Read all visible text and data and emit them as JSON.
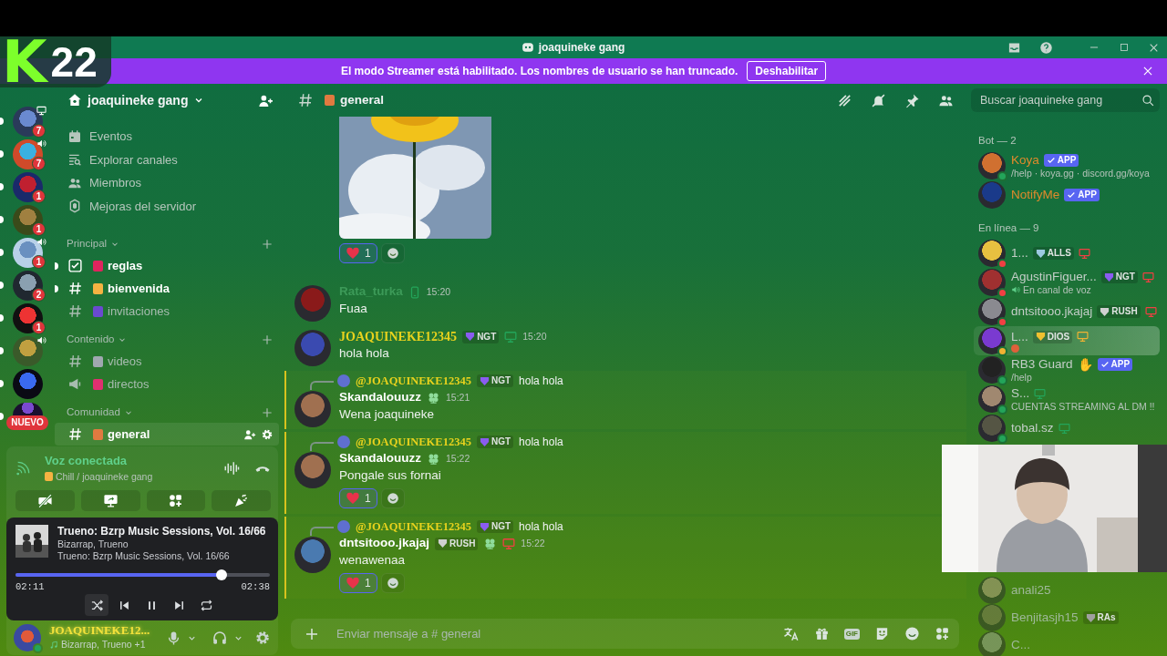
{
  "window": {
    "title": "joaquineke gang"
  },
  "overlay_logo": {
    "letter": "K",
    "number": "22"
  },
  "streamer_banner": {
    "message": "El modo Streamer está habilitado. Los nombres de usuario se han truncado.",
    "button": "Deshabilitar"
  },
  "servers": [
    {
      "unread": true,
      "badge": "7",
      "voice": false,
      "streaming": true
    },
    {
      "unread": true,
      "badge": "7",
      "voice": true,
      "streaming": false
    },
    {
      "unread": true,
      "badge": "1",
      "voice": false,
      "streaming": false
    },
    {
      "unread": true,
      "badge": "1",
      "voice": false,
      "streaming": false
    },
    {
      "unread": true,
      "badge": "1",
      "voice": true,
      "streaming": false
    },
    {
      "unread": true,
      "badge": "2",
      "voice": false,
      "streaming": false
    },
    {
      "unread": true,
      "badge": "1",
      "voice": false,
      "streaming": false
    },
    {
      "unread": true,
      "voice": true,
      "streaming": false
    },
    {
      "unread": true,
      "voice": false,
      "streaming": false
    },
    {
      "unread": true,
      "voice": false,
      "streaming": false,
      "label": "NUEVO"
    }
  ],
  "channel_sidebar": {
    "server_name": "joaquineke gang",
    "menu": [
      {
        "label": "Eventos"
      },
      {
        "label": "Explorar canales"
      },
      {
        "label": "Miembros"
      },
      {
        "label": "Mejoras del servidor"
      }
    ],
    "categories": [
      {
        "name": "Principal",
        "channels": [
          {
            "name": "reglas",
            "kind": "rules",
            "unread": true,
            "selected": false
          },
          {
            "name": "bienvenida",
            "kind": "text",
            "unread": true,
            "selected": false
          },
          {
            "name": "invitaciones",
            "kind": "text",
            "unread": false,
            "selected": false
          }
        ]
      },
      {
        "name": "Contenido",
        "channels": [
          {
            "name": "videos",
            "kind": "text",
            "unread": false,
            "selected": false
          },
          {
            "name": "directos",
            "kind": "announcement",
            "unread": false,
            "selected": false
          }
        ]
      },
      {
        "name": "Comunidad",
        "channels": [
          {
            "name": "general",
            "kind": "text",
            "unread": false,
            "selected": true
          }
        ]
      }
    ]
  },
  "voice": {
    "status": "Voz conectada",
    "channel": "Chill / joaquineke gang"
  },
  "now_playing": {
    "title": "Trueno: Bzrp Music Sessions, Vol. 16/66",
    "artists": "Bizarrap, Trueno",
    "album": "Trueno: Bzrp Music Sessions, Vol. 16/66",
    "level": 0.81,
    "elapsed": "02:11",
    "duration": "02:38",
    "shuffle": true
  },
  "user": {
    "name": "JOAQUINEKE12...",
    "activity": "Bizarrap, Trueno +1",
    "status": {
      "color": "#23a55a"
    },
    "fancy_name": true
  },
  "chat": {
    "channel": "general",
    "search": {
      "placeholder": "Buscar joaquineke gang"
    },
    "messages": [
      {
        "reactions": [
          {
            "count": "1",
            "selected": true
          }
        ]
      },
      {
        "kind": "message",
        "author": "Rata_turka",
        "color": "#3c9a58",
        "mobile": true,
        "status": {
          "color": "#23a55a"
        },
        "time": "15:20",
        "text": "Fuaa"
      },
      {
        "kind": "message",
        "author": "JOAQUINEKE12345",
        "color": "#e8d21d",
        "fancy_name": true,
        "tag": {
          "text": "NGT",
          "color": "#8a5cf0"
        },
        "desktop": true,
        "status": {
          "color": "#23a55a"
        },
        "time": "15:20",
        "text": "hola hola"
      },
      {
        "kind": "reply",
        "mentioned": true,
        "reply": {
          "author": "@JOAQUINEKE12345",
          "color": "#e8d21d",
          "fancy_name": true,
          "tag": {
            "text": "NGT",
            "color": "#8a5cf0"
          },
          "text": "hola hola"
        },
        "author": "Skandalouuzz",
        "color": "#ffffff",
        "badge": true,
        "time": "15:21",
        "text": "Wena joaquineke"
      },
      {
        "kind": "reply",
        "mentioned": true,
        "reply": {
          "author": "@JOAQUINEKE12345",
          "color": "#e8d21d",
          "fancy_name": true,
          "tag": {
            "text": "NGT",
            "color": "#8a5cf0"
          },
          "text": "hola hola"
        },
        "author": "Skandalouuzz",
        "color": "#ffffff",
        "badge": true,
        "time": "15:22",
        "text": "Pongale sus fornai",
        "reactions": [
          {
            "count": "1",
            "selected": true
          }
        ]
      },
      {
        "kind": "reply",
        "mentioned": true,
        "reply": {
          "author": "@JOAQUINEKE12345",
          "color": "#e8d21d",
          "fancy_name": true,
          "tag": {
            "text": "NGT",
            "color": "#8a5cf0"
          },
          "text": "hola hola"
        },
        "author": "dntsitooo.jkajaj",
        "color": "#ffffff",
        "tag": {
          "text": "RUSH",
          "color": "#d0d0d0"
        },
        "badge": true,
        "desktop": true,
        "status": {
          "color": "#f23f43"
        },
        "time": "15:22",
        "text": "wenawenaa",
        "reactions": [
          {
            "count": "1",
            "selected": true
          }
        ]
      }
    ],
    "input": {
      "placeholder": "Enviar mensaje a # general",
      "gif_label": "GIF"
    }
  },
  "members": [
    {
      "title": "Bot — 2",
      "members": [
        {
          "name": "Koya",
          "color": "#e08a2c",
          "status": {
            "color": "#23a55a"
          },
          "tag": {
            "text": "APP",
            "kind": "app"
          },
          "subtitle": "/help · koya.gg · discord.gg/koya"
        },
        {
          "name": "NotifyMe",
          "color": "#e08a2c",
          "tag": {
            "text": "APP",
            "kind": "app"
          }
        }
      ]
    },
    {
      "title": "En línea — 9",
      "members": [
        {
          "name": "1...",
          "status": {
            "color": "#f23f43"
          },
          "tag": {
            "text": "ALLS",
            "kind": "role",
            "color": "#9cc8e0"
          },
          "desktop": true
        },
        {
          "name": "AgustinFiguer...",
          "status": {
            "color": "#f23f43"
          },
          "tag": {
            "text": "NGT",
            "kind": "role",
            "color": "#8a5cf0"
          },
          "desktop": true,
          "subtitle": "En canal de voz",
          "in_voice": true
        },
        {
          "name": "dntsitooo.jkajaj",
          "status": {
            "color": "#f23f43"
          },
          "tag": {
            "text": "RUSH",
            "kind": "role",
            "color": "#d0d0d0"
          },
          "desktop": true
        },
        {
          "name": "L...",
          "status": {
            "color": "#f0b232"
          },
          "tag": {
            "text": "DIOS",
            "kind": "role",
            "color": "#f0c030"
          },
          "desktop": true,
          "highlighted": true,
          "status_emoji": true
        },
        {
          "name": "RB3 Guard",
          "status": {
            "color": "#23a55a"
          },
          "emoji": "✋",
          "tag": {
            "text": "APP",
            "kind": "app"
          },
          "subtitle": "/help"
        },
        {
          "name": "S...",
          "status": {
            "color": "#23a55a"
          },
          "desktop": true,
          "subtitle": "CUENTAS STREAMING AL DM !!"
        },
        {
          "name": "tobal.sz",
          "status": {
            "color": "#23a55a"
          },
          "desktop": true
        }
      ]
    },
    {
      "members": [
        {
          "name": "anali25",
          "offline": true
        },
        {
          "name": "Benjitasjh15",
          "offline": true,
          "tag": {
            "text": "RAs",
            "kind": "role",
            "color": "#a0a0a0"
          }
        },
        {
          "name": "C...",
          "offline": true
        }
      ]
    }
  ]
}
